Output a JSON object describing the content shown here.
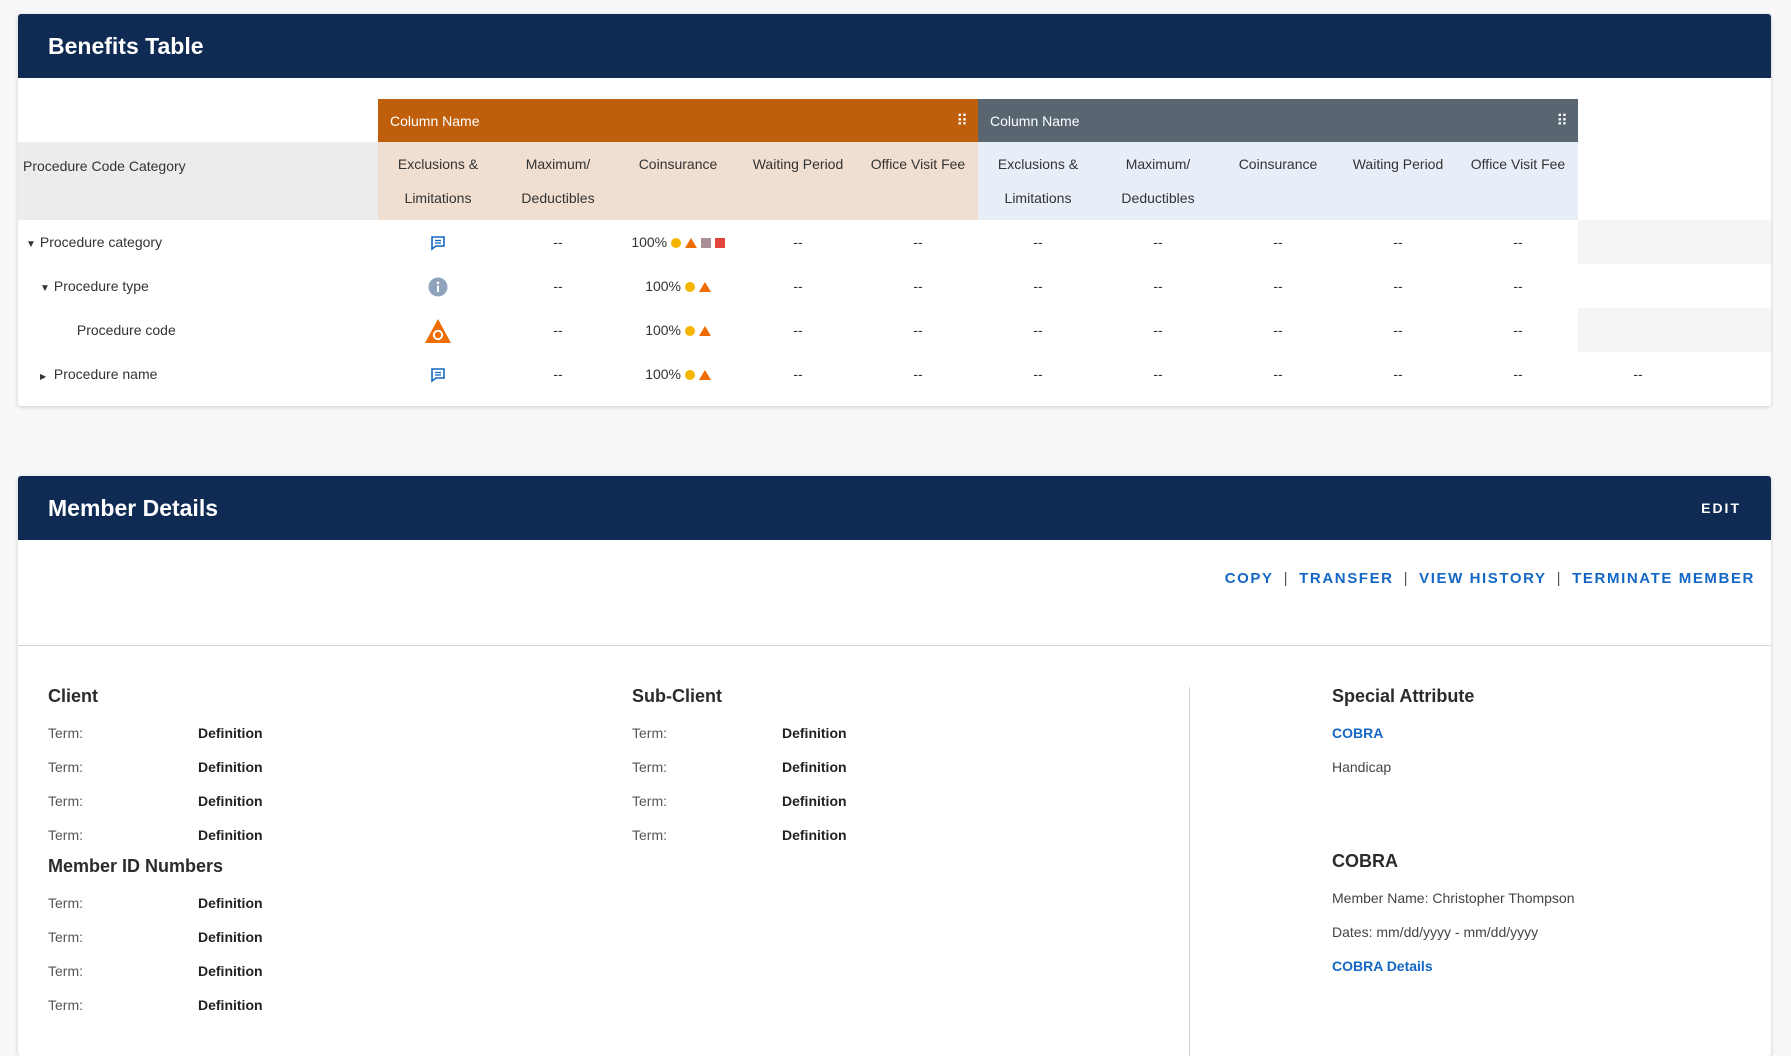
{
  "benefits": {
    "title": "Benefits Table",
    "groups": [
      {
        "label": "Column Name",
        "color": "#bf5f0c"
      },
      {
        "label": "Column Name",
        "color": "#596570"
      }
    ],
    "category_header": "Procedure Code Category",
    "columns": [
      [
        "Exclusions &",
        "Limitations"
      ],
      [
        "Maximum/",
        "Deductibles"
      ],
      [
        "Coinsurance"
      ],
      [
        "Waiting Period"
      ],
      [
        "Office Visit Fee"
      ]
    ],
    "rows": [
      {
        "label": "Procedure category",
        "caret": "▼",
        "icon": "comment-icon",
        "coinsurance": "100%",
        "markers": [
          "circle",
          "triangle",
          "square-gray",
          "square-red"
        ]
      },
      {
        "label": "Procedure type",
        "caret": "▼",
        "icon": "info-icon",
        "coinsurance": "100%",
        "markers": [
          "circle",
          "triangle"
        ]
      },
      {
        "label": "Procedure code",
        "caret": "",
        "icon": "warning-triangle-icon",
        "coinsurance": "100%",
        "markers": [
          "circle",
          "triangle"
        ]
      },
      {
        "label": "Procedure name",
        "caret": "▶",
        "icon": "comment-icon",
        "coinsurance": "100%",
        "markers": [
          "circle",
          "triangle"
        ]
      }
    ],
    "empty": "--",
    "colors": {
      "orange_header_bg": "#f0dfd0",
      "slate_header_bg": "#e7eef8",
      "circle": "#f4b400",
      "triangle": "#ef6c00",
      "square_gray": "#a89096",
      "square_red": "#e2453c",
      "icon_blue": "#1467c4",
      "info_gray": "#8fa3bb"
    }
  },
  "member": {
    "title": "Member Details",
    "edit": "EDIT",
    "actions": [
      "COPY",
      "TRANSFER",
      "VIEW HISTORY",
      "TERMINATE MEMBER"
    ],
    "client": {
      "title": "Client",
      "items": [
        {
          "term": "Term:",
          "def": "Definition"
        },
        {
          "term": "Term:",
          "def": "Definition"
        },
        {
          "term": "Term:",
          "def": "Definition"
        },
        {
          "term": "Term:",
          "def": "Definition"
        }
      ]
    },
    "member_ids": {
      "title": "Member ID Numbers",
      "items": [
        {
          "term": "Term:",
          "def": "Definition"
        },
        {
          "term": "Term:",
          "def": "Definition"
        },
        {
          "term": "Term:",
          "def": "Definition"
        },
        {
          "term": "Term:",
          "def": "Definition"
        }
      ]
    },
    "sub_client": {
      "title": "Sub-Client",
      "items": [
        {
          "term": "Term:",
          "def": "Definition"
        },
        {
          "term": "Term:",
          "def": "Definition"
        },
        {
          "term": "Term:",
          "def": "Definition"
        },
        {
          "term": "Term:",
          "def": "Definition"
        }
      ]
    },
    "special": {
      "title": "Special Attribute",
      "link": "COBRA",
      "text": "Handicap"
    },
    "cobra": {
      "title": "COBRA",
      "member_name": "Member Name: Christopher Thompson",
      "dates": "Dates: mm/dd/yyyy - mm/dd/yyyy",
      "details_link": "COBRA Details"
    }
  }
}
